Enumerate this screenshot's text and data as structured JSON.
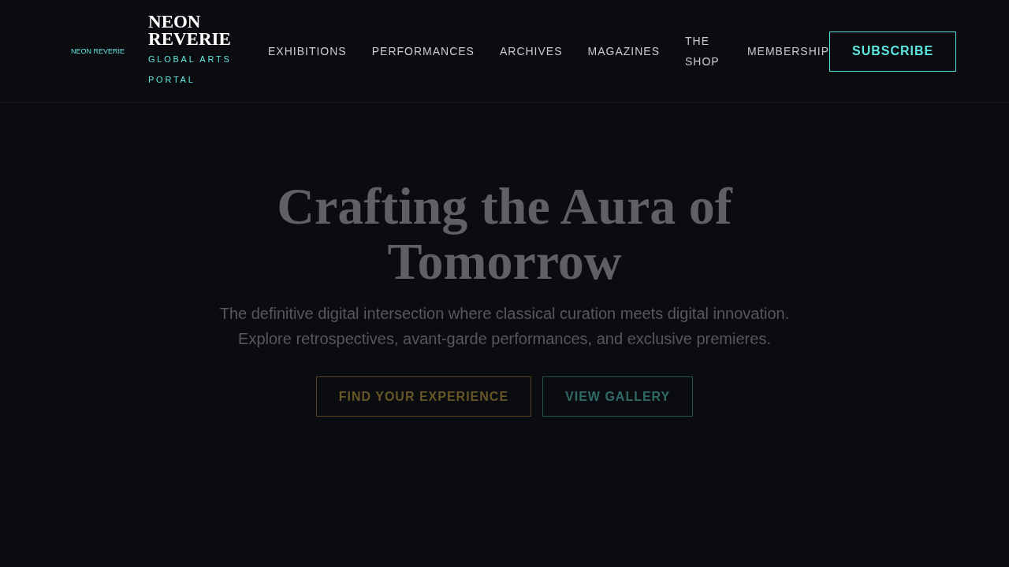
{
  "header": {
    "logo_alt": "NEON REVERIE",
    "brand": {
      "title": "NEON REVERIE",
      "tagline": "GLOBAL ARTS PORTAL"
    },
    "nav": [
      "EXHIBITIONS",
      "PERFORMANCES",
      "ARCHIVES",
      "MAGAZINES",
      "THE SHOP",
      "MEMBERSHIP"
    ],
    "subscribe_button": "SUBSCRIBE"
  },
  "hero": {
    "title": "Crafting the Aura of Tomorrow",
    "subtitle": "The definitive digital intersection where classical curation meets digital innovation. Explore retrospectives, avant-garde performances, and exclusive premieres.",
    "buttons": [
      {
        "label": "FIND YOUR EXPERIENCE",
        "kind": "primary"
      },
      {
        "label": "VIEW GALLERY",
        "kind": "secondary"
      }
    ]
  }
}
